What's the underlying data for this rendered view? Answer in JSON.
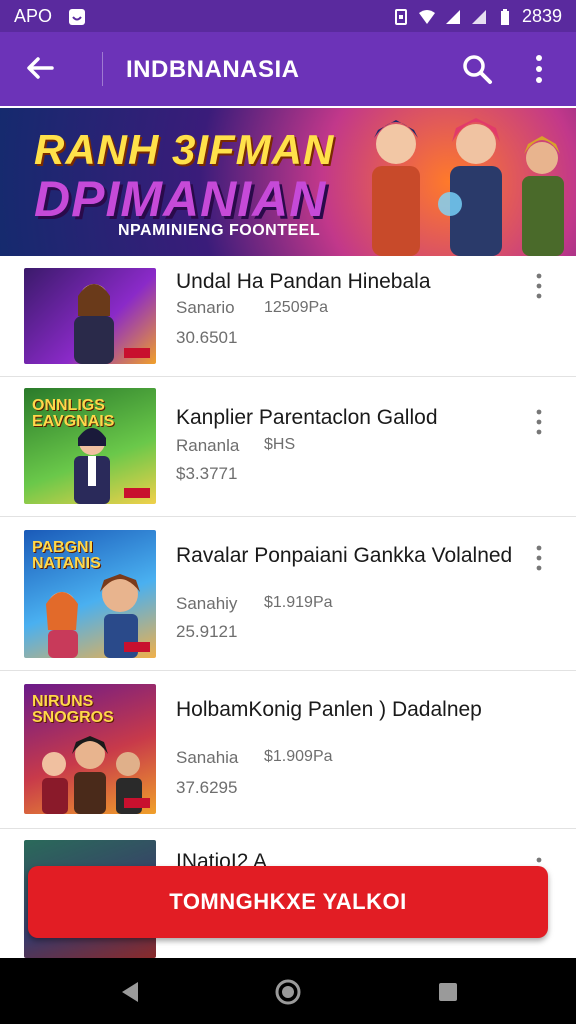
{
  "status": {
    "left_label": "APO",
    "time": "2839",
    "icons": [
      "notification-icon",
      "sim-icon",
      "wifi-icon",
      "signal-icon",
      "signal-icon",
      "battery-icon"
    ]
  },
  "appbar": {
    "title": "INDBNANASIA"
  },
  "banner": {
    "line1": "RANH 3IFMAN",
    "line2": "DPIMANIAN",
    "line3": "NPAMINIENG FOONTEEL"
  },
  "items": [
    {
      "title": "Undal Ha Pandan Hinebala",
      "meta": "Sanario",
      "meta2": "12509Pa",
      "price": "30.6501"
    },
    {
      "title": "Kanplier Parentaclon Gallod",
      "meta": "Rananla",
      "meta2": "$HS",
      "price": "$3.3771"
    },
    {
      "title": "Ravalar Ponpaiani Gankka Volalned",
      "meta": "Sanahiy",
      "meta2": "$1.919Pa",
      "price": "25.9121"
    },
    {
      "title": "HolbamKonig Panlen ) Dadalnep",
      "meta": "Sanahia",
      "meta2": "$1.909Pa",
      "price": "37.6295"
    },
    {
      "title": "INatioI2 A",
      "meta": "",
      "meta2": "",
      "price": ""
    }
  ],
  "thumbs": [
    {
      "badge": ""
    },
    {
      "badge": "ONNLIGS EAVGNAIS"
    },
    {
      "badge": "PABGNI NATANIS"
    },
    {
      "badge": "NIRUNS SNOGROS"
    },
    {
      "badge": ""
    }
  ],
  "cta": {
    "label": "TOMNGHKXE YALKOI"
  },
  "colors": {
    "appbar": "#6c33b8",
    "statusbar": "#5a2a9e",
    "cta": "#e21d24"
  }
}
